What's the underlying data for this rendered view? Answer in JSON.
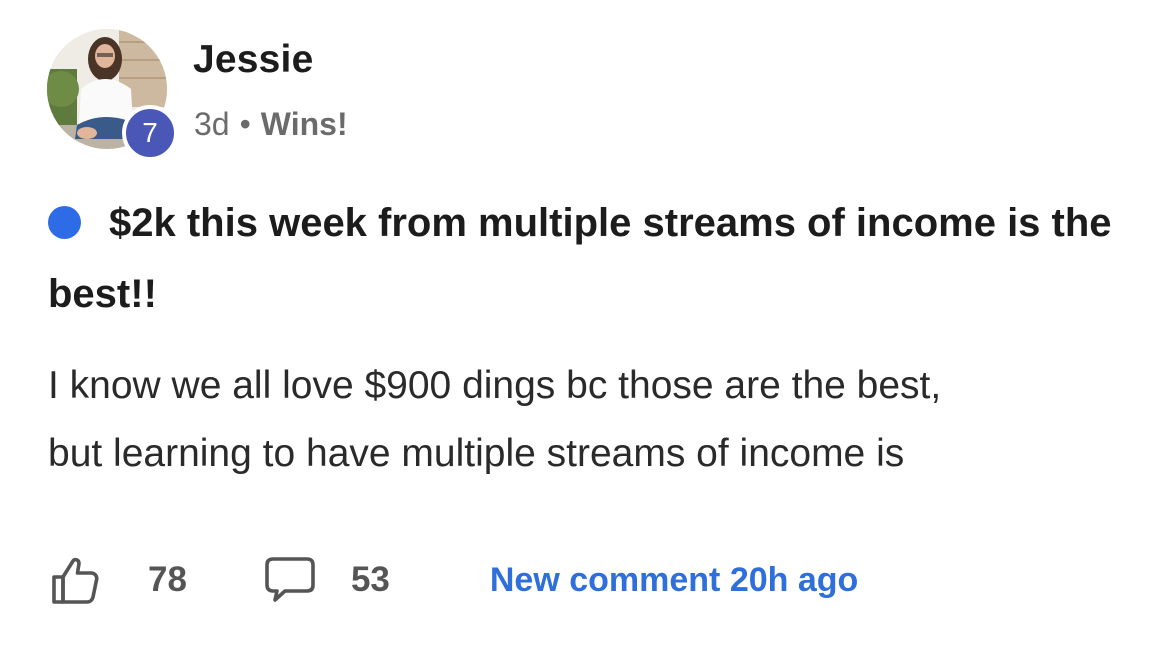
{
  "author": {
    "name": "Jessie",
    "level": "7"
  },
  "meta": {
    "time": "3d",
    "separator": "•",
    "category": "Wins!"
  },
  "post": {
    "title": "$2k this week from multiple streams of income is the best!!",
    "body_line1": "I know we all love $900 dings bc those are the best,",
    "body_line2": "but learning to have multiple streams of income is"
  },
  "footer": {
    "likes": "78",
    "comments": "53",
    "new_comment": "New comment 20h ago"
  },
  "colors": {
    "accent_blue": "#2f6fdc",
    "unread_dot": "#2e6be6",
    "level_badge": "#4b57b7"
  },
  "icons": {
    "like": "thumbs-up-icon",
    "comment": "speech-bubble-icon"
  }
}
